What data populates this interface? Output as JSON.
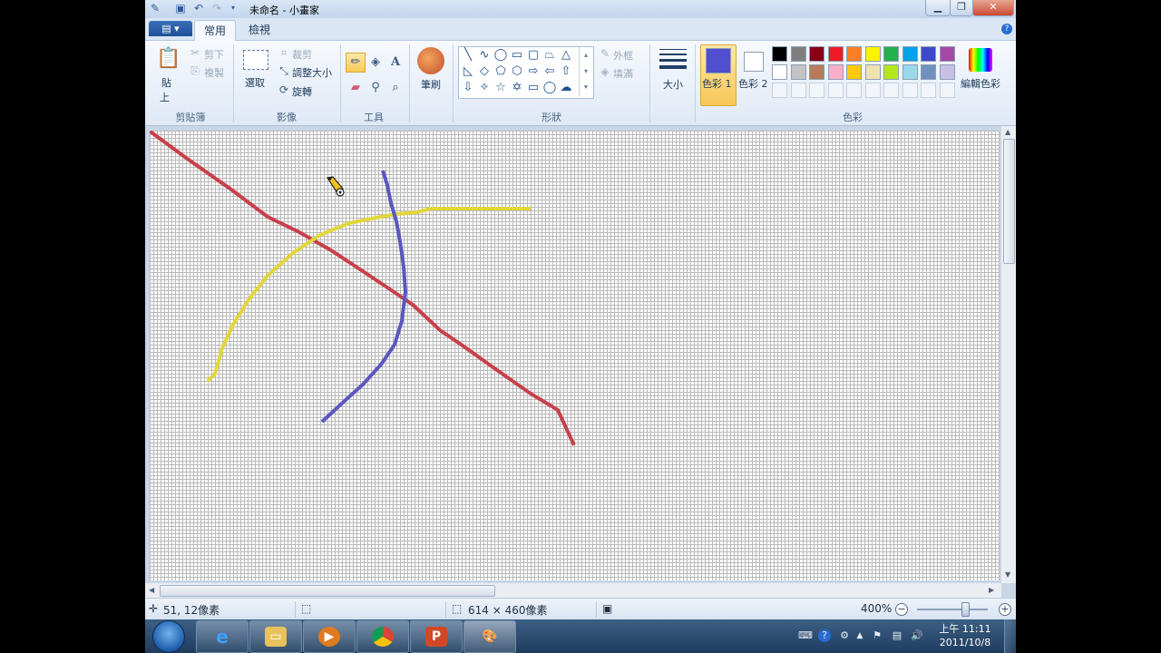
{
  "window": {
    "title": "未命名 - 小畫家",
    "controls": [
      "minimize",
      "maximize",
      "close"
    ]
  },
  "quick_access": [
    "save-icon",
    "undo-icon",
    "redo-icon",
    "customize-icon"
  ],
  "ribbon_tabs": [
    "常用",
    "檢視"
  ],
  "active_tab": "常用",
  "ribbon": {
    "clipboard": {
      "paste": "貼",
      "paste2": "上",
      "cut": "剪下",
      "copy": "複製",
      "label": "剪貼簿"
    },
    "image": {
      "select": "選取",
      "crop": "裁剪",
      "resize": "調整大小",
      "rotate": "旋轉",
      "label": "影像"
    },
    "tools": {
      "label": "工具",
      "selected": "pencil"
    },
    "brushes": {
      "label": "筆刷"
    },
    "shapes": {
      "outline": "外框",
      "fill": "填滿",
      "label": "形狀"
    },
    "size": {
      "label": "大小"
    },
    "colors": {
      "color1_label": "色彩 1",
      "color2_label": "色彩 2",
      "edit_label": "編輯色彩",
      "label": "色彩",
      "color1": "#4f4fcf",
      "color2": "#ffffff",
      "palette_row1": [
        "#000000",
        "#7f7f7f",
        "#880015",
        "#ed1c24",
        "#ff7f27",
        "#fff200",
        "#22b14c",
        "#00a2e8",
        "#3f48cc",
        "#a349a4"
      ],
      "palette_row2": [
        "#ffffff",
        "#c3c3c3",
        "#b97a57",
        "#ffaec9",
        "#ffc90e",
        "#efe4b0",
        "#b5e61d",
        "#99d9ea",
        "#7092be",
        "#c8bfe7"
      ]
    }
  },
  "canvas": {
    "strokes": [
      {
        "color": "#c8404a",
        "name": "red-line"
      },
      {
        "color": "#e2d63b",
        "name": "yellow-curve"
      },
      {
        "color": "#5a57c0",
        "name": "blue-curve"
      }
    ]
  },
  "status": {
    "cursor_pos": "51, 12像素",
    "image_size": "614 × 460像素",
    "zoom": "400%"
  },
  "taskbar": {
    "apps": [
      "ie-icon",
      "explorer-icon",
      "media-player-icon",
      "chrome-icon",
      "powerpoint-icon",
      "paint-icon"
    ],
    "time": "上午 11:11",
    "date": "2011/10/8"
  }
}
